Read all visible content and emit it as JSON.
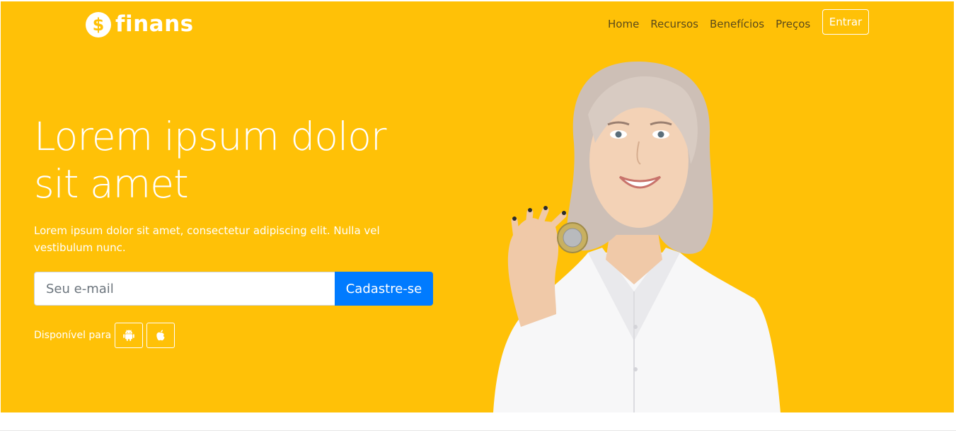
{
  "brand": {
    "name": "finans",
    "icon": "dollar-coin-icon",
    "icon_glyph": "$"
  },
  "nav": {
    "items": [
      "Home",
      "Recursos",
      "Benefícios",
      "Preços"
    ],
    "login_label": "Entrar"
  },
  "hero": {
    "headline": "Lorem ipsum dolor sit amet",
    "lead": "Lorem ipsum dolor sit amet, consectetur adipiscing elit. Nulla vel vestibulum nunc.",
    "email_placeholder": "Seu e-mail",
    "signup_label": "Cadastre-se",
    "available_label": "Disponível para",
    "stores": [
      "android-icon",
      "apple-icon"
    ]
  },
  "colors": {
    "hero_bg": "#FFC107",
    "primary": "#007BFF",
    "nav_text": "#5b4a1a"
  }
}
